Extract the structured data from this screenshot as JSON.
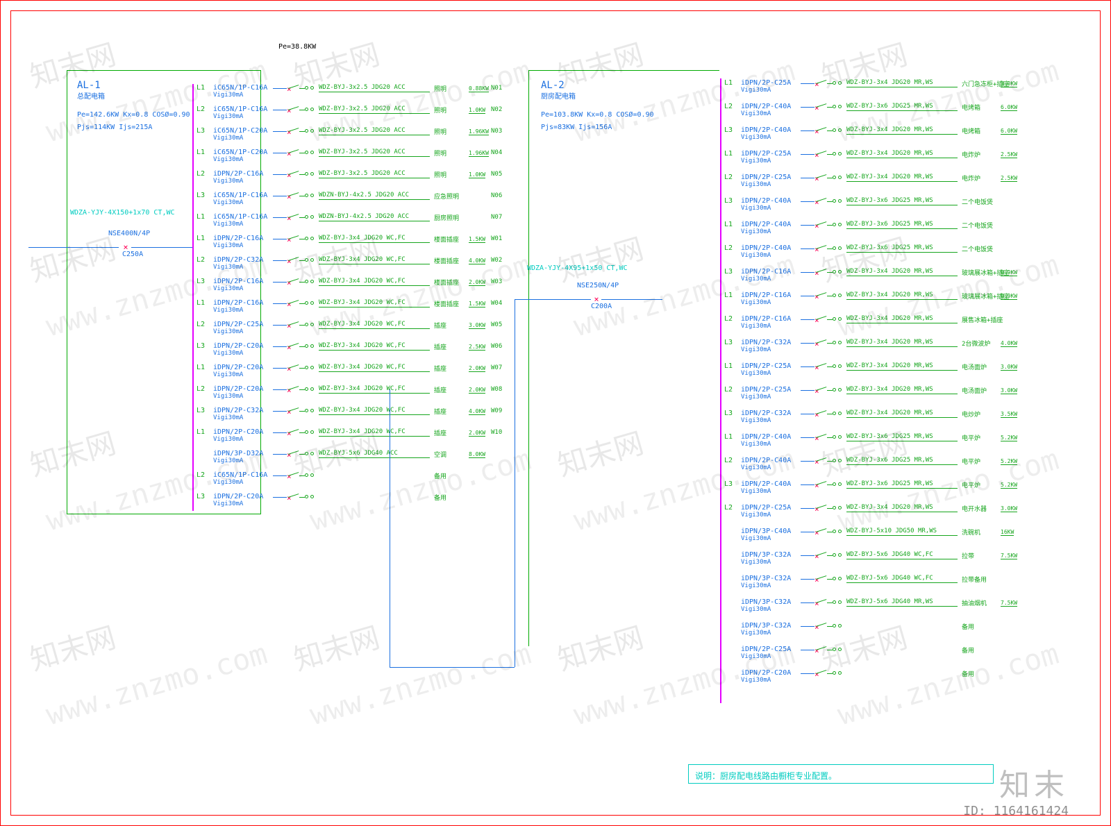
{
  "page": {
    "pe_top": "Pe=38.8KW",
    "watermark_text": "www.znzmo.com",
    "watermark_cn": "知末网",
    "logo": "知末",
    "id_label": "ID: 1164161424"
  },
  "al1": {
    "title": "AL-1",
    "subtitle": "总配电箱",
    "params": [
      "Pe=142.6KW   Kx=0.8   COSØ=0.90",
      "Pjs=114KW   Ijs=215A"
    ],
    "feeder": "WDZA-YJY-4X150+1x70  CT,WC",
    "main_cb": "NSE400N/4P",
    "main_cb2": "C250A",
    "circuits": [
      {
        "ph": "L1",
        "bk": "iC65N/1P-C16A",
        "vi": "Vigi30mA",
        "cbl": "WDZ-BYJ-3x2.5 JDG20 ACC",
        "desc": "照明",
        "pw": "0.88KW",
        "id": "N01"
      },
      {
        "ph": "L2",
        "bk": "iC65N/1P-C16A",
        "vi": "Vigi30mA",
        "cbl": "WDZ-BYJ-3x2.5 JDG20 ACC",
        "desc": "照明",
        "pw": "1.0KW",
        "id": "N02"
      },
      {
        "ph": "L3",
        "bk": "iC65N/1P-C20A",
        "vi": "Vigi30mA",
        "cbl": "WDZ-BYJ-3x2.5 JDG20 ACC",
        "desc": "照明",
        "pw": "1.96KW",
        "id": "N03"
      },
      {
        "ph": "L1",
        "bk": "iC65N/1P-C20A",
        "vi": "Vigi30mA",
        "cbl": "WDZ-BYJ-3x2.5 JDG20 ACC",
        "desc": "照明",
        "pw": "1.96KW",
        "id": "N04"
      },
      {
        "ph": "L2",
        "bk": "iDPN/2P-C16A",
        "vi": "Vigi30mA",
        "cbl": "WDZ-BYJ-3x2.5 JDG20 ACC",
        "desc": "照明",
        "pw": "1.0KW",
        "id": "N05"
      },
      {
        "ph": "L3",
        "bk": "iC65N/1P-C16A",
        "vi": "Vigi30mA",
        "cbl": "WDZN-BYJ-4x2.5 JDG20 ACC",
        "desc": "应急照明",
        "pw": "",
        "id": "N06"
      },
      {
        "ph": "L1",
        "bk": "iC65N/1P-C16A",
        "vi": "Vigi30mA",
        "cbl": "WDZN-BYJ-4x2.5 JDG20 ACC",
        "desc": "厨房照明",
        "pw": "",
        "id": "N07"
      },
      {
        "ph": "L1",
        "bk": "iDPN/2P-C16A",
        "vi": "Vigi30mA",
        "cbl": "WDZ-BYJ-3x4 JDG20 WC,FC",
        "desc": "楼面插座",
        "pw": "1.5KW",
        "id": "W01"
      },
      {
        "ph": "L2",
        "bk": "iDPN/2P-C32A",
        "vi": "Vigi30mA",
        "cbl": "WDZ-BYJ-3x4 JDG20 WC,FC",
        "desc": "楼面插座",
        "pw": "4.0KW",
        "id": "W02"
      },
      {
        "ph": "L3",
        "bk": "iDPN/2P-C16A",
        "vi": "Vigi30mA",
        "cbl": "WDZ-BYJ-3x4 JDG20 WC,FC",
        "desc": "楼面插座",
        "pw": "2.0KW",
        "id": "W03"
      },
      {
        "ph": "L1",
        "bk": "iDPN/2P-C16A",
        "vi": "Vigi30mA",
        "cbl": "WDZ-BYJ-3x4 JDG20 WC,FC",
        "desc": "楼面插座",
        "pw": "1.5KW",
        "id": "W04"
      },
      {
        "ph": "L2",
        "bk": "iDPN/2P-C25A",
        "vi": "Vigi30mA",
        "cbl": "WDZ-BYJ-3x4 JDG20 WC,FC",
        "desc": "插座",
        "pw": "3.0KW",
        "id": "W05"
      },
      {
        "ph": "L3",
        "bk": "iDPN/2P-C20A",
        "vi": "Vigi30mA",
        "cbl": "WDZ-BYJ-3x4 JDG20 WC,FC",
        "desc": "插座",
        "pw": "2.5KW",
        "id": "W06"
      },
      {
        "ph": "L1",
        "bk": "iDPN/2P-C20A",
        "vi": "Vigi30mA",
        "cbl": "WDZ-BYJ-3x4 JDG20 WC,FC",
        "desc": "插座",
        "pw": "2.0KW",
        "id": "W07"
      },
      {
        "ph": "L2",
        "bk": "iDPN/2P-C20A",
        "vi": "Vigi30mA",
        "cbl": "WDZ-BYJ-3x4 JDG20 WC,FC",
        "desc": "插座",
        "pw": "2.0KW",
        "id": "W08"
      },
      {
        "ph": "L3",
        "bk": "iDPN/2P-C32A",
        "vi": "Vigi30mA",
        "cbl": "WDZ-BYJ-3x4 JDG20 WC,FC",
        "desc": "插座",
        "pw": "4.0KW",
        "id": "W09"
      },
      {
        "ph": "L1",
        "bk": "iDPN/2P-C20A",
        "vi": "Vigi30mA",
        "cbl": "WDZ-BYJ-3x4 JDG20 WC,FC",
        "desc": "插座",
        "pw": "2.0KW",
        "id": "W10"
      },
      {
        "ph": "",
        "bk": "iDPN/3P-D32A",
        "vi": "Vigi30mA",
        "cbl": "WDZ-BYJ-5x6 JDG40 ACC",
        "desc": "空调",
        "pw": "8.0KW",
        "id": ""
      },
      {
        "ph": "L2",
        "bk": "iC65N/1P-C16A",
        "vi": "Vigi30mA",
        "cbl": "",
        "desc": "备用",
        "pw": "",
        "id": ""
      },
      {
        "ph": "L3",
        "bk": "iDPN/2P-C20A",
        "vi": "Vigi30mA",
        "cbl": "",
        "desc": "备用",
        "pw": "",
        "id": ""
      }
    ]
  },
  "al2": {
    "title": "AL-2",
    "subtitle": "厨房配电箱",
    "params": [
      "Pe=103.8KW   Kx=0.8   COSØ=0.90",
      "Pjs=83KW   Ijs=156A"
    ],
    "feeder": "WDZA-YJY-4X95+1x50  CT,WC",
    "main_cb": "NSE250N/4P",
    "main_cb2": "C200A",
    "circuits": [
      {
        "ph": "L1",
        "bk": "iDPN/2P-C25A",
        "vi": "Vigi30mA",
        "cbl": "WDZ-BYJ-3x4 JDG20 MR,WS",
        "desc": "六门急冻柜+插座",
        "pw": "3.0KW",
        "id": ""
      },
      {
        "ph": "L2",
        "bk": "iDPN/2P-C40A",
        "vi": "Vigi30mA",
        "cbl": "WDZ-BYJ-3x6 JDG25 MR,WS",
        "desc": "电烤箱",
        "pw": "6.0KW",
        "id": ""
      },
      {
        "ph": "L3",
        "bk": "iDPN/2P-C40A",
        "vi": "Vigi30mA",
        "cbl": "WDZ-BYJ-3x4 JDG20 MR,WS",
        "desc": "电烤箱",
        "pw": "6.0KW",
        "id": ""
      },
      {
        "ph": "L1",
        "bk": "iDPN/2P-C25A",
        "vi": "Vigi30mA",
        "cbl": "WDZ-BYJ-3x4 JDG20 MR,WS",
        "desc": "电炸炉",
        "pw": "2.5KW",
        "id": ""
      },
      {
        "ph": "L2",
        "bk": "iDPN/2P-C25A",
        "vi": "Vigi30mA",
        "cbl": "WDZ-BYJ-3x4 JDG20 MR,WS",
        "desc": "电炸炉",
        "pw": "2.5KW",
        "id": ""
      },
      {
        "ph": "L3",
        "bk": "iDPN/2P-C40A",
        "vi": "Vigi30mA",
        "cbl": "WDZ-BYJ-3x6 JDG25 MR,WS",
        "desc": "二个电饭煲",
        "pw": "",
        "id": ""
      },
      {
        "ph": "L1",
        "bk": "iDPN/2P-C40A",
        "vi": "Vigi30mA",
        "cbl": "WDZ-BYJ-3x6 JDG25 MR,WS",
        "desc": "二个电饭煲",
        "pw": "",
        "id": ""
      },
      {
        "ph": "L2",
        "bk": "iDPN/2P-C40A",
        "vi": "Vigi30mA",
        "cbl": "WDZ-BYJ-3x6 JDG25 MR,WS",
        "desc": "二个电饭煲",
        "pw": "",
        "id": ""
      },
      {
        "ph": "L3",
        "bk": "iDPN/2P-C16A",
        "vi": "Vigi30mA",
        "cbl": "WDZ-BYJ-3x4 JDG20 MR,WS",
        "desc": "玻璃展冰箱+插座",
        "pw": "0.9KW",
        "id": ""
      },
      {
        "ph": "L1",
        "bk": "iDPN/2P-C16A",
        "vi": "Vigi30mA",
        "cbl": "WDZ-BYJ-3x4 JDG20 MR,WS",
        "desc": "玻璃展冰箱+插座",
        "pw": "0.9KW",
        "id": ""
      },
      {
        "ph": "L2",
        "bk": "iDPN/2P-C16A",
        "vi": "Vigi30mA",
        "cbl": "WDZ-BYJ-3x4 JDG20 MR,WS",
        "desc": "展售冰箱+插座",
        "pw": "",
        "id": ""
      },
      {
        "ph": "L3",
        "bk": "iDPN/2P-C32A",
        "vi": "Vigi30mA",
        "cbl": "WDZ-BYJ-3x4 JDG20 MR,WS",
        "desc": "2台微波炉",
        "pw": "4.0KW",
        "id": ""
      },
      {
        "ph": "L1",
        "bk": "iDPN/2P-C25A",
        "vi": "Vigi30mA",
        "cbl": "WDZ-BYJ-3x4 JDG20 MR,WS",
        "desc": "电汤面炉",
        "pw": "3.0KW",
        "id": ""
      },
      {
        "ph": "L2",
        "bk": "iDPN/2P-C25A",
        "vi": "Vigi30mA",
        "cbl": "WDZ-BYJ-3x4 JDG20 MR,WS",
        "desc": "电汤面炉",
        "pw": "3.0KW",
        "id": ""
      },
      {
        "ph": "L3",
        "bk": "iDPN/2P-C32A",
        "vi": "Vigi30mA",
        "cbl": "WDZ-BYJ-3x4 JDG20 MR,WS",
        "desc": "电炒炉",
        "pw": "3.5KW",
        "id": ""
      },
      {
        "ph": "L1",
        "bk": "iDPN/2P-C40A",
        "vi": "Vigi30mA",
        "cbl": "WDZ-BYJ-3x6 JDG25 MR,WS",
        "desc": "电平炉",
        "pw": "5.2KW",
        "id": ""
      },
      {
        "ph": "L2",
        "bk": "iDPN/2P-C40A",
        "vi": "Vigi30mA",
        "cbl": "WDZ-BYJ-3x6 JDG25 MR,WS",
        "desc": "电平炉",
        "pw": "5.2KW",
        "id": ""
      },
      {
        "ph": "L3",
        "bk": "iDPN/2P-C40A",
        "vi": "Vigi30mA",
        "cbl": "WDZ-BYJ-3x6 JDG25 MR,WS",
        "desc": "电平炉",
        "pw": "5.2KW",
        "id": ""
      },
      {
        "ph": "L2",
        "bk": "iDPN/2P-C25A",
        "vi": "Vigi30mA",
        "cbl": "WDZ-BYJ-3x4 JDG20 MR,WS",
        "desc": "电开水器",
        "pw": "3.0KW",
        "id": ""
      },
      {
        "ph": "",
        "bk": "iDPN/3P-C40A",
        "vi": "Vigi30mA",
        "cbl": "WDZ-BYJ-5x10 JDG50 MR,WS",
        "desc": "洗碗机",
        "pw": "16KW",
        "id": ""
      },
      {
        "ph": "",
        "bk": "iDPN/3P-C32A",
        "vi": "Vigi30mA",
        "cbl": "WDZ-BYJ-5x6 JDG40 WC,FC",
        "desc": "拉带",
        "pw": "7.5KW",
        "id": ""
      },
      {
        "ph": "",
        "bk": "iDPN/3P-C32A",
        "vi": "Vigi30mA",
        "cbl": "WDZ-BYJ-5x6 JDG40 WC,FC",
        "desc": "拉带备用",
        "pw": "",
        "id": ""
      },
      {
        "ph": "",
        "bk": "iDPN/3P-C32A",
        "vi": "Vigi30mA",
        "cbl": "WDZ-BYJ-5x6 JDG40 MR,WS",
        "desc": "抽油烟机",
        "pw": "7.5KW",
        "id": ""
      },
      {
        "ph": "",
        "bk": "iDPN/3P-C32A",
        "vi": "Vigi30mA",
        "cbl": "",
        "desc": "备用",
        "pw": "",
        "id": ""
      },
      {
        "ph": "",
        "bk": "iDPN/2P-C25A",
        "vi": "Vigi30mA",
        "cbl": "",
        "desc": "备用",
        "pw": "",
        "id": ""
      },
      {
        "ph": "",
        "bk": "iDPN/2P-C20A",
        "vi": "Vigi30mA",
        "cbl": "",
        "desc": "备用",
        "pw": "",
        "id": ""
      }
    ]
  },
  "note": "说明：厨房配电线路由橱柜专业配置。"
}
